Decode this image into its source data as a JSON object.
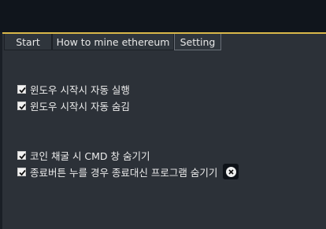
{
  "tabs": [
    {
      "label": "Start",
      "active": false
    },
    {
      "label": "How to mine ethereum",
      "active": false
    },
    {
      "label": "Setting",
      "active": true
    }
  ],
  "options": [
    {
      "label": "윈도우 시작시 자동 실행",
      "checked": true
    },
    {
      "label": "윈도우 시작시 자동 숨김",
      "checked": true
    },
    {
      "label": "코인 채굴 시 CMD 창 숨기기",
      "checked": true
    },
    {
      "label": "종료버튼 누를 경우 종료대신 프로그램 숨기기",
      "checked": true
    }
  ],
  "icons": {
    "checkbox_mark": "check-icon",
    "close": "close-icon"
  },
  "colors": {
    "background": "#2c3138",
    "titlebar": "#10151c",
    "accent": "#d9b84a",
    "text": "#ececec"
  }
}
